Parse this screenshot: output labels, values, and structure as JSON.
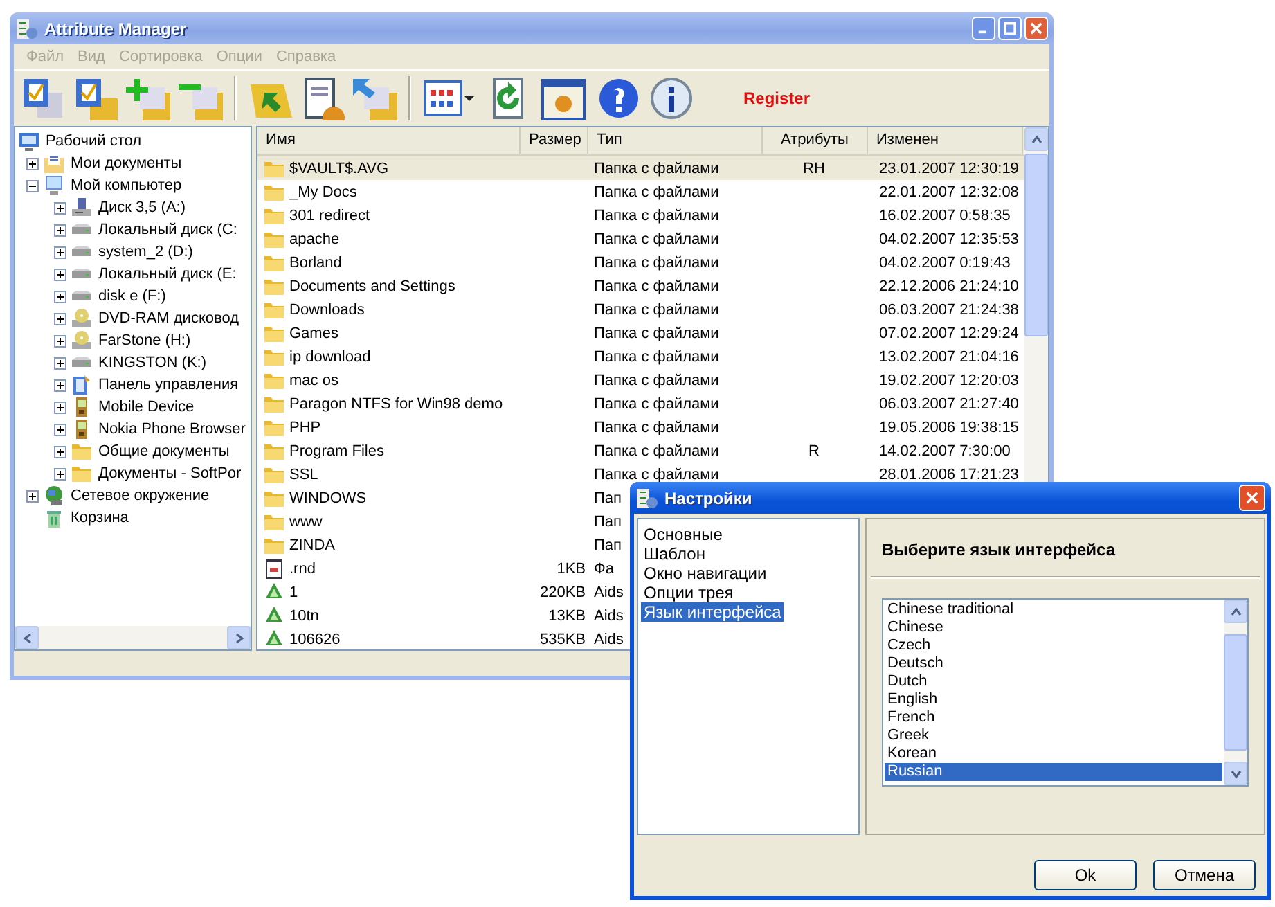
{
  "window": {
    "title": "Attribute Manager"
  },
  "menu": [
    "Файл",
    "Вид",
    "Сортировка",
    "Опции",
    "Справка"
  ],
  "toolbar": {
    "register": "Register"
  },
  "tree": [
    {
      "label": "Рабочий стол",
      "kind": "desktop",
      "children": [
        {
          "label": "Мои документы",
          "kind": "documents",
          "expanded": false
        },
        {
          "label": "Мой компьютер",
          "kind": "computer",
          "expanded": true,
          "children": [
            {
              "label": "Диск 3,5 (A:)",
              "kind": "floppy",
              "expanded": false
            },
            {
              "label": "Локальный диск (C:",
              "kind": "drive",
              "expanded": false
            },
            {
              "label": "system_2 (D:)",
              "kind": "drive",
              "expanded": false
            },
            {
              "label": "Локальный диск (E:",
              "kind": "drive",
              "expanded": false
            },
            {
              "label": "disk e (F:)",
              "kind": "drive",
              "expanded": false
            },
            {
              "label": "DVD-RAM дисковод",
              "kind": "disc",
              "expanded": false
            },
            {
              "label": "FarStone (H:)",
              "kind": "disc",
              "expanded": false
            },
            {
              "label": "KINGSTON (K:)",
              "kind": "drive",
              "expanded": false
            },
            {
              "label": "Панель управления",
              "kind": "control",
              "expanded": false
            },
            {
              "label": "Mobile Device",
              "kind": "phone",
              "expanded": false
            },
            {
              "label": "Nokia Phone Browser",
              "kind": "phone",
              "expanded": false
            },
            {
              "label": "Общие документы",
              "kind": "folder",
              "expanded": false
            },
            {
              "label": "Документы - SoftPor",
              "kind": "folder",
              "expanded": false
            }
          ]
        },
        {
          "label": "Сетевое окружение",
          "kind": "network",
          "expanded": false
        },
        {
          "label": "Корзина",
          "kind": "trash"
        }
      ]
    }
  ],
  "list": {
    "columns": [
      "Имя",
      "Размер",
      "Тип",
      "Атрибуты",
      "Изменен"
    ],
    "rows": [
      {
        "kind": "folder",
        "selected": true,
        "name": "$VAULT$.AVG",
        "type": "Папка с файлами",
        "attributes": "RH",
        "modified": "23.01.2007 12:30:19"
      },
      {
        "kind": "folder",
        "selected": false,
        "name": "_My Docs",
        "type": "Папка с файлами",
        "modified": "22.01.2007 12:32:08"
      },
      {
        "kind": "folder",
        "selected": false,
        "name": "301 redirect",
        "type": "Папка с файлами",
        "modified": "16.02.2007 0:58:35"
      },
      {
        "kind": "folder",
        "selected": false,
        "name": "apache",
        "type": "Папка с файлами",
        "modified": "04.02.2007 12:35:53"
      },
      {
        "kind": "folder",
        "selected": false,
        "name": "Borland",
        "type": "Папка с файлами",
        "modified": "04.02.2007 0:19:43"
      },
      {
        "kind": "folder",
        "selected": false,
        "name": "Documents and Settings",
        "type": "Папка с файлами",
        "modified": "22.12.2006 21:24:10"
      },
      {
        "kind": "folder",
        "selected": false,
        "name": "Downloads",
        "type": "Папка с файлами",
        "modified": "06.03.2007 21:24:38"
      },
      {
        "kind": "folder",
        "selected": false,
        "name": "Games",
        "type": "Папка с файлами",
        "modified": "07.02.2007 12:29:24"
      },
      {
        "kind": "folder",
        "selected": false,
        "name": "ip download",
        "type": "Папка с файлами",
        "modified": "13.02.2007 21:04:16"
      },
      {
        "kind": "folder",
        "selected": false,
        "name": "mac os",
        "type": "Папка с файлами",
        "modified": "19.02.2007 12:20:03"
      },
      {
        "kind": "folder",
        "selected": false,
        "name": "Paragon NTFS for Win98 demo",
        "type": "Папка с файлами",
        "modified": "06.03.2007 21:27:40"
      },
      {
        "kind": "folder",
        "selected": false,
        "name": "PHP",
        "type": "Папка с файлами",
        "modified": "19.05.2006 19:38:15"
      },
      {
        "kind": "folder",
        "selected": false,
        "name": "Program Files",
        "type": "Папка с файлами",
        "attributes": "R",
        "modified": "14.02.2007 7:30:00"
      },
      {
        "kind": "folder",
        "selected": false,
        "name": "SSL",
        "type": "Папка с файлами",
        "modified": "28.01.2006 17:21:23"
      },
      {
        "kind": "folder",
        "selected": false,
        "name": "WINDOWS",
        "type": "Пап"
      },
      {
        "kind": "folder",
        "selected": false,
        "name": "www",
        "type": "Пап"
      },
      {
        "kind": "folder",
        "selected": false,
        "name": "ZINDA",
        "type": "Пап"
      },
      {
        "kind": "file",
        "selected": false,
        "name": ".rnd",
        "size": "1KB",
        "type": "Фа"
      },
      {
        "kind": "aids",
        "selected": false,
        "name": "1",
        "size": "220KB",
        "type": "Aids"
      },
      {
        "kind": "aids",
        "selected": false,
        "name": "10tn",
        "size": "13KB",
        "type": "Aids"
      },
      {
        "kind": "aids",
        "selected": false,
        "name": "106626",
        "size": "535KB",
        "type": "Aids"
      }
    ]
  },
  "dialog": {
    "title": "Настройки",
    "nav": [
      {
        "label": "Основные",
        "selected": false
      },
      {
        "label": "Шаблон",
        "selected": false
      },
      {
        "label": "Окно навигации",
        "selected": false
      },
      {
        "label": "Опции трея",
        "selected": false
      },
      {
        "label": "Язык интерфейса",
        "selected": true
      }
    ],
    "heading": "Выберите язык интерфейса",
    "languages": [
      {
        "label": "Chinese traditional",
        "selected": false
      },
      {
        "label": "Chinese",
        "selected": false
      },
      {
        "label": "Czech",
        "selected": false
      },
      {
        "label": "Deutsch",
        "selected": false
      },
      {
        "label": "Dutch",
        "selected": false
      },
      {
        "label": "English",
        "selected": false
      },
      {
        "label": "French",
        "selected": false
      },
      {
        "label": "Greek",
        "selected": false
      },
      {
        "label": "Korean",
        "selected": false
      },
      {
        "label": "Russian",
        "selected": true
      }
    ],
    "buttons": [
      "Ok",
      "Отмена"
    ]
  }
}
